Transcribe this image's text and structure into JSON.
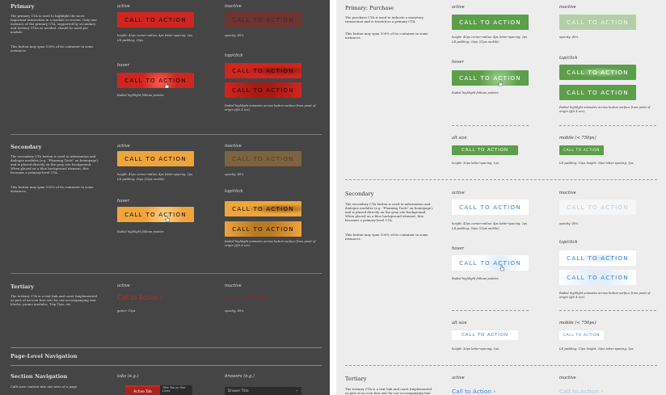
{
  "cta": "CALL TO ACTION",
  "cta_link": "Call to Action",
  "state_active": "active",
  "state_inactive": "inactive",
  "state_hover": "hover",
  "state_tap": "tap/click",
  "state_alt": "alt size",
  "state_mobile": "mobile (< 750px)",
  "radial_caption": "Radial highlight animates across button surface from point of origin (@0.4 sec).",
  "radial_follow": "Radial highlight follows pointer.",
  "left": {
    "primary": {
      "title": "Primary",
      "desc1": "The primary CTA is used to highlight the most important interaction in a module or screen. Only one instance of the primary CTA, supported by secondary and tertiary CTAs as needed, should be used per module.",
      "desc2": "This button may span 100% of its container in some instances.",
      "meta1": "height: 43px   corner-radius: 4px   letter-spacing: 2px",
      "meta2": "LR padding: 30px",
      "inactive_meta": "opacity: 40%"
    },
    "secondary": {
      "title": "Secondary",
      "desc1": "The secondary CTA button is used in information and dialogue modules (e.g. \"Planning Tools\" on homepage), and is placed directly on the gray site background. When placed on a blue background element, this becomes a primary-level CTA.",
      "desc2": "This button may span 100% of its container in some instances.",
      "meta1": "height: 43px   corner-radius: 4px   letter-spacing: 2px",
      "meta2": "LR padding: 30px (15px mobile)",
      "inactive_meta": "opacity: 40%"
    },
    "tertiary": {
      "title": "Tertiary",
      "desc": "The tertiary CTA is a text link and caret (implemented as part of an icon font set) for use accompanying text blocks, promo modules, Trip Tips, etc.",
      "meta": "gutter: 15px",
      "inactive_meta": "opacity: 40%"
    },
    "plnav": {
      "title": "Page-Level Navigation"
    },
    "secnav": {
      "title": "Section Navigation",
      "desc": "Calls new content into one area of a page.",
      "tabs_label": "tabs (e.g.)",
      "drawers_label": "drawers (e.g.)",
      "tab_active": "Active Tab",
      "tab_other": "Title Tab on Two Lines",
      "drawer_title": "Drawer Title"
    }
  },
  "right": {
    "primary": {
      "title": "Primary: Purchase",
      "desc1": "The purchase CTA is used to indicate a monetary transaction and is treated as a primary CTA.",
      "desc2": "This button may span 100% of its container in some instances.",
      "meta1": "height: 43px   corner-radius: 4px   letter-spacing: 2px",
      "meta2": "LR padding: 30px (15px mobile)",
      "inactive_meta": "opacity: 40%",
      "alt_meta": "height: 30px     letter-spacing: 1px",
      "mobile_meta": "LR padding: 15px    height: 30px    letter-spacing: 1px"
    },
    "secondary": {
      "title": "Secondary",
      "desc1": "The secondary CTA button is used in information and dialogue modules (e.g. \"Planning Tools\" on homepage), and is placed directly on the gray site background. When placed on a blue background element, this becomes a primary-level CTA.",
      "desc2": "This button may span 100% of its container in some instances.",
      "meta1": "height: 43px   corner-radius: 4px   letter-spacing: 2px",
      "meta2": "LR padding: 30px (15px mobile)",
      "inactive_meta": "opacity: 40%",
      "alt_meta": "height: 30px     letter-spacing: 1px",
      "mobile_meta": "LR padding: 15px    height: 30px    letter-spacing: 1px"
    },
    "tertiary": {
      "title": "Tertiary",
      "desc": "The tertiary CTA is a text link and caret (implemented as part of an icon font set) for use accompanying text"
    }
  },
  "colors": {
    "red": "#d0261f",
    "orange": "#f0a43c",
    "green": "#5c9e49",
    "blue": "#3b86cf"
  }
}
